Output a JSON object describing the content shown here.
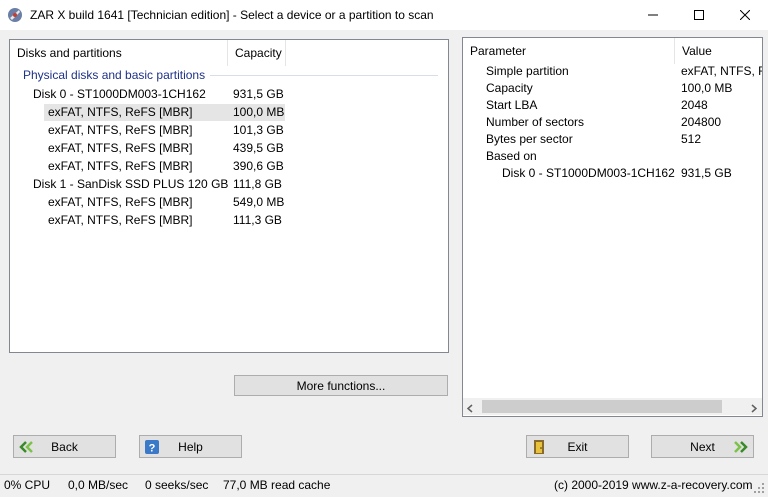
{
  "window": {
    "title": "ZAR X build 1641 [Technician edition] - Select a device or a partition to scan",
    "minimize_glyph": "—",
    "maximize_glyph": "☐",
    "close_glyph": "✕"
  },
  "left_panel": {
    "col_name": "Disks and partitions",
    "col_capacity": "Capacity",
    "group_label": "Physical disks and basic partitions",
    "rows": [
      {
        "name": "Disk 0 - ST1000DM003-1CH162",
        "capacity": "931,5 GB"
      },
      {
        "name": "exFAT, NTFS, ReFS [MBR]",
        "capacity": "100,0 MB"
      },
      {
        "name": "exFAT, NTFS, ReFS [MBR]",
        "capacity": "101,3 GB"
      },
      {
        "name": "exFAT, NTFS, ReFS [MBR]",
        "capacity": "439,5 GB"
      },
      {
        "name": "exFAT, NTFS, ReFS [MBR]",
        "capacity": "390,6 GB"
      },
      {
        "name": "Disk 1 - SanDisk SSD PLUS 120 GB",
        "capacity": "111,8 GB"
      },
      {
        "name": "exFAT, NTFS, ReFS [MBR]",
        "capacity": "549,0 MB"
      },
      {
        "name": "exFAT, NTFS, ReFS [MBR]",
        "capacity": "111,3 GB"
      }
    ]
  },
  "more_functions_label": "More functions...",
  "right_panel": {
    "col_param": "Parameter",
    "col_value": "Value",
    "rows": [
      {
        "param": "Simple partition",
        "value": "exFAT, NTFS, R"
      },
      {
        "param": "Capacity",
        "value": "100,0 MB"
      },
      {
        "param": "Start LBA",
        "value": "2048"
      },
      {
        "param": "Number of sectors",
        "value": "204800"
      },
      {
        "param": "Bytes per sector",
        "value": "512"
      },
      {
        "param": "Based on",
        "value": ""
      },
      {
        "param": "Disk 0 - ST1000DM003-1CH162",
        "value": "931,5 GB"
      }
    ]
  },
  "buttons": {
    "back": "Back",
    "help": "Help",
    "exit": "Exit",
    "next": "Next"
  },
  "statusbar": {
    "cpu": "0% CPU",
    "throughput": "0,0 MB/sec",
    "seeks": "0 seeks/sec",
    "cache": "77,0 MB read cache",
    "copyright": "(c) 2000-2019 www.z-a-recovery.com"
  }
}
